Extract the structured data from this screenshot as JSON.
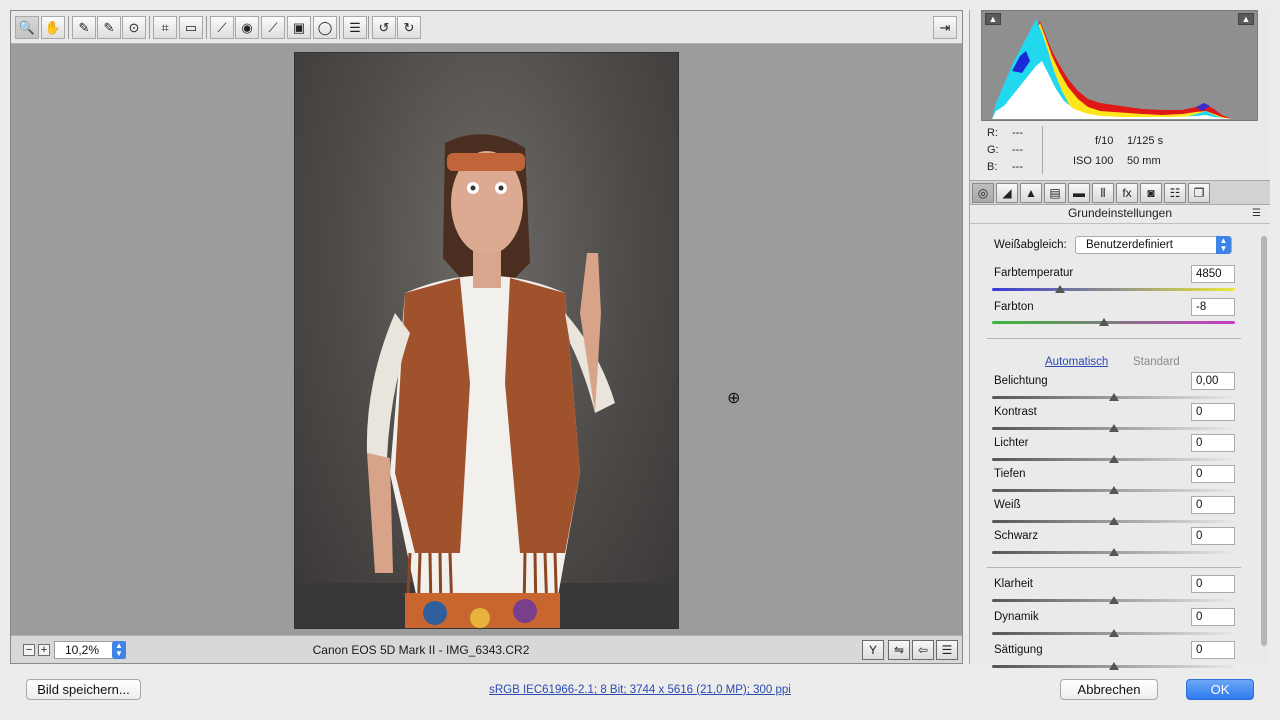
{
  "toolbar": {
    "tools": [
      {
        "name": "zoom-tool",
        "icon": "magnifier-icon",
        "glyph": "🔍"
      },
      {
        "name": "hand-tool",
        "icon": "hand-icon",
        "glyph": "✋"
      },
      {
        "name": "white-balance-tool",
        "icon": "eyedropper-icon",
        "glyph": "✎"
      },
      {
        "name": "color-sampler-tool",
        "icon": "color-sampler-icon",
        "glyph": "✎"
      },
      {
        "name": "targeted-adjustment-tool",
        "icon": "target-adjust-icon",
        "glyph": "⊙"
      },
      {
        "name": "crop-tool",
        "icon": "crop-icon",
        "glyph": "⌗"
      },
      {
        "name": "straighten-tool",
        "icon": "straighten-icon",
        "glyph": "▭"
      },
      {
        "name": "spot-removal-tool",
        "icon": "spot-removal-icon",
        "glyph": "⟋"
      },
      {
        "name": "red-eye-tool",
        "icon": "eye-icon",
        "glyph": "◉"
      },
      {
        "name": "adjustment-brush-tool",
        "icon": "brush-icon",
        "glyph": "⟋"
      },
      {
        "name": "graduated-filter-tool",
        "icon": "graduated-filter-icon",
        "glyph": "▣"
      },
      {
        "name": "radial-filter-tool",
        "icon": "radial-filter-icon",
        "glyph": "◯"
      },
      {
        "name": "preferences-tool",
        "icon": "list-icon",
        "glyph": "☰"
      },
      {
        "name": "rotate-left-tool",
        "icon": "rotate-left-icon",
        "glyph": "↺"
      },
      {
        "name": "rotate-right-tool",
        "icon": "rotate-right-icon",
        "glyph": "↻"
      }
    ],
    "fullscreen_glyph": "⇥"
  },
  "statusbar": {
    "zoom_out": "−",
    "zoom_in": "+",
    "zoom_value": "10,2%",
    "file_name": "Canon EOS 5D Mark II - IMG_6343.CR2",
    "view_icons": [
      "Y",
      "⇋",
      "⇦",
      "☰"
    ]
  },
  "info": {
    "r_label": "R:",
    "r_value": "---",
    "g_label": "G:",
    "g_value": "---",
    "b_label": "B:",
    "b_value": "---",
    "aperture": "f/10",
    "shutter": "1/125 s",
    "iso": "ISO 100",
    "focal": "50 mm"
  },
  "panel": {
    "title": "Grundeinstellungen",
    "tabs": [
      "◎",
      "◢",
      "▲",
      "▤",
      "▬",
      "⦀",
      "fx",
      "◙",
      "☷",
      "❐"
    ]
  },
  "basic": {
    "wb_label": "Weißabgleich:",
    "wb_value": "Benutzerdefiniert",
    "temp_label": "Farbtemperatur",
    "temp_value": "4850",
    "temp_level": 0.28,
    "tint_label": "Farbton",
    "tint_value": "-8",
    "tint_level": 0.46,
    "auto": "Automatisch",
    "standard": "Standard",
    "sliders": [
      {
        "label": "Belichtung",
        "value": "0,00"
      },
      {
        "label": "Kontrast",
        "value": "0"
      },
      {
        "label": "Lichter",
        "value": "0"
      },
      {
        "label": "Tiefen",
        "value": "0"
      },
      {
        "label": "Weiß",
        "value": "0"
      },
      {
        "label": "Schwarz",
        "value": "0"
      }
    ],
    "presence": [
      {
        "label": "Klarheit",
        "value": "0"
      },
      {
        "label": "Dynamik",
        "value": "0"
      },
      {
        "label": "Sättigung",
        "value": "0"
      }
    ]
  },
  "footer": {
    "save_label": "Bild speichern...",
    "workflow": "sRGB IEC61966-2.1; 8 Bit; 3744 x 5616 (21,0 MP); 300 ppi",
    "cancel_label": "Abbrechen",
    "ok_label": "OK"
  }
}
